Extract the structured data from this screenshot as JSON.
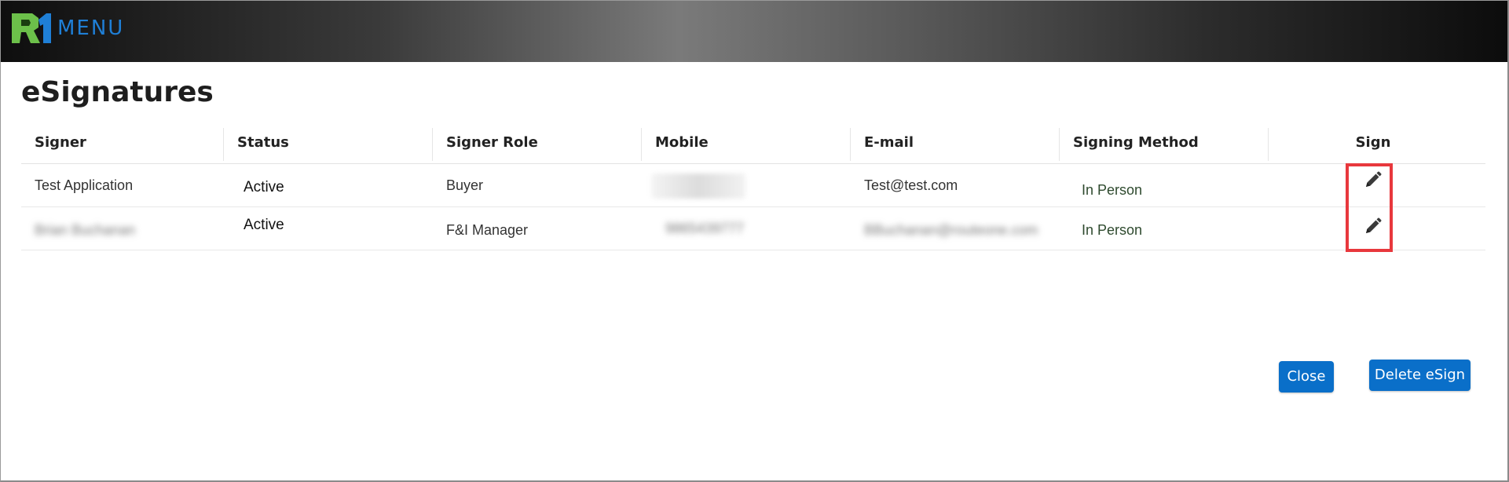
{
  "header": {
    "logo_text": "MENU"
  },
  "page": {
    "title": "eSignatures"
  },
  "table": {
    "columns": [
      "Signer",
      "Status",
      "Signer Role",
      "Mobile",
      "E-mail",
      "Signing Method",
      "Sign"
    ],
    "rows": [
      {
        "signer": "Test Application",
        "status": "Active",
        "role": "Buyer",
        "mobile": "",
        "email": "Test@test.com",
        "method": "In Person",
        "sign_icon": "pencil-icon"
      },
      {
        "signer": "Brian Buchanan",
        "status": "Active",
        "role": "F&I Manager",
        "mobile": "9865439777",
        "email": "BBuchanan@routeone.com",
        "method": "In Person",
        "sign_icon": "pencil-icon"
      }
    ]
  },
  "actions": {
    "close_label": "Close",
    "delete_label": "Delete eSign"
  },
  "colors": {
    "accent": "#0a6fc9",
    "logo_green": "#6cc04a",
    "logo_blue": "#1f7fd6",
    "highlight": "#e8383d",
    "method_text": "#2e4a2e"
  }
}
